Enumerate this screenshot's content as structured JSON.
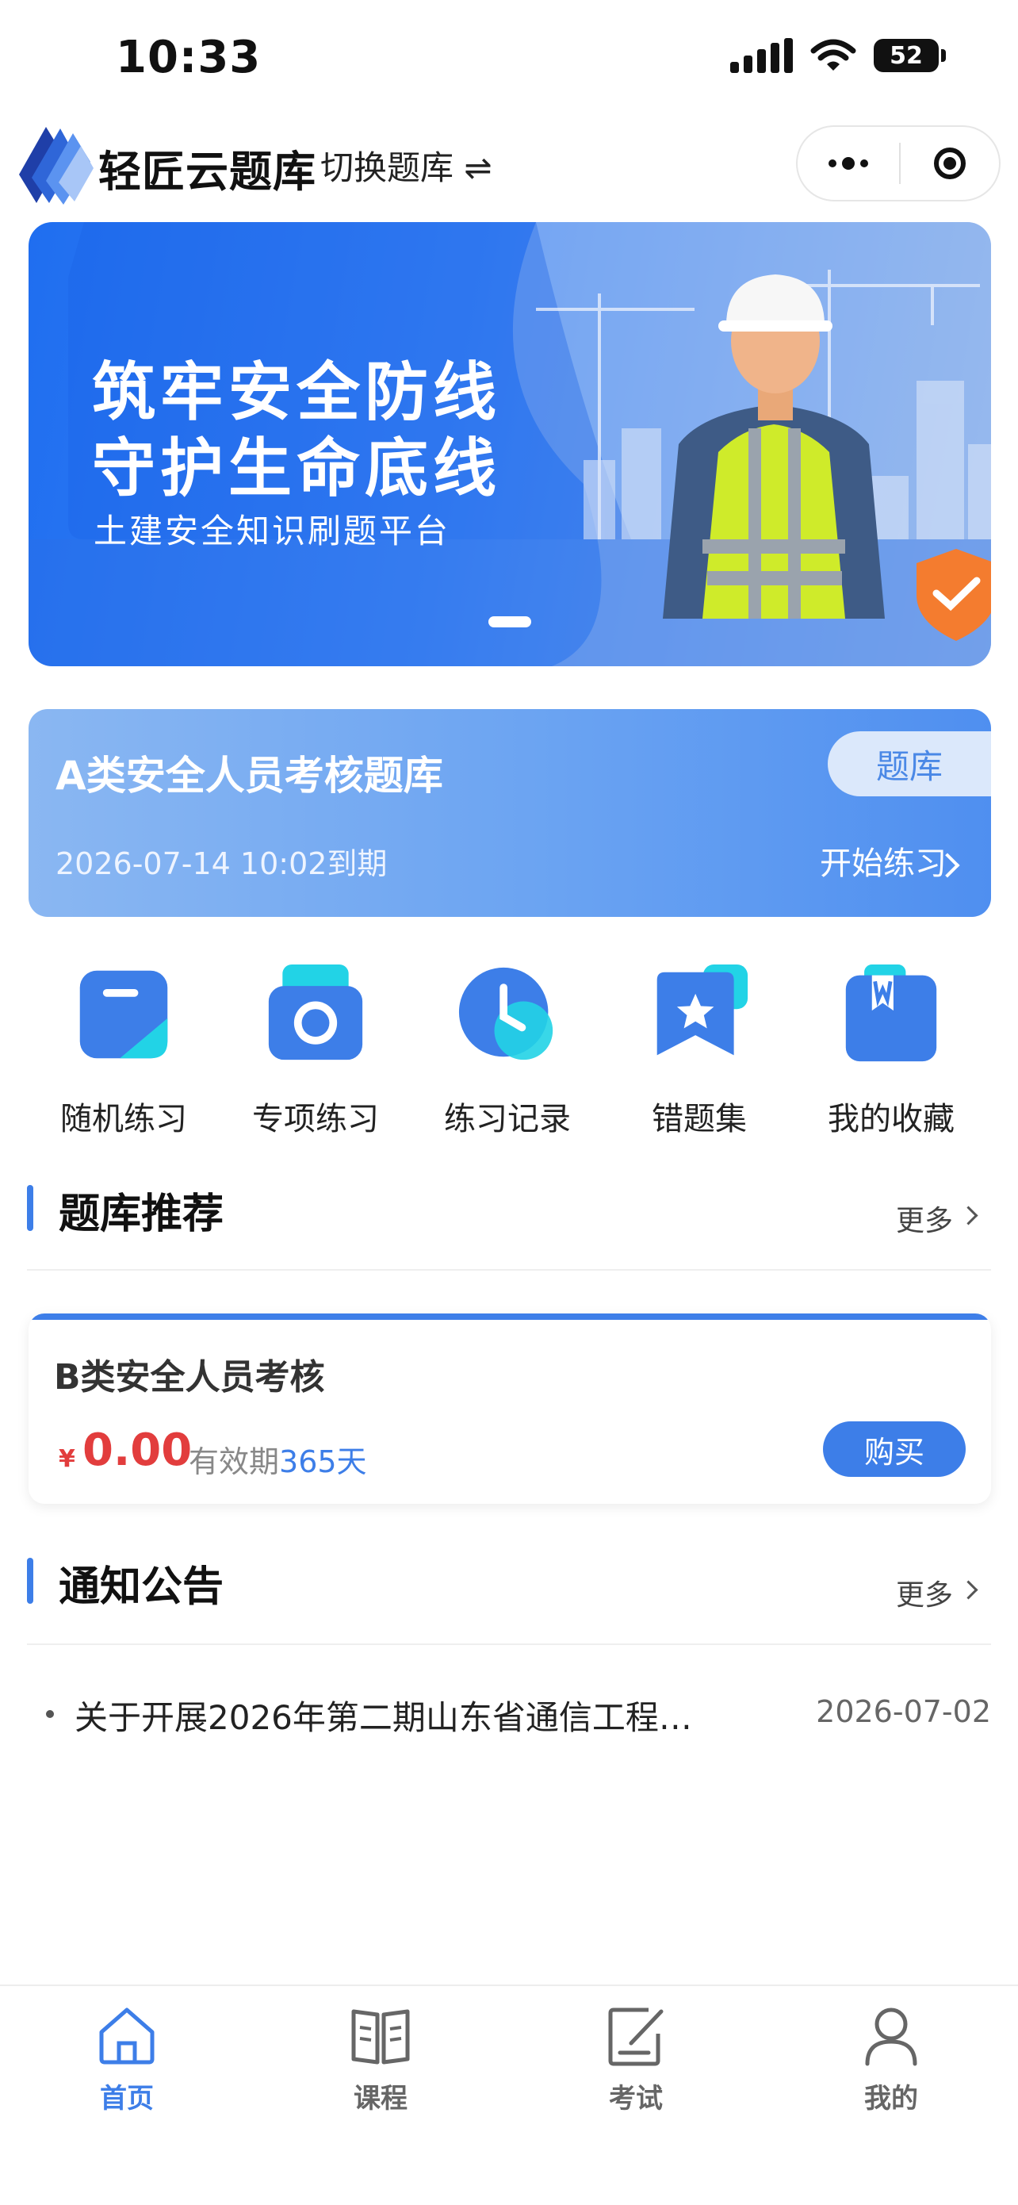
{
  "status_bar": {
    "time": "10:33",
    "battery": "52"
  },
  "header": {
    "app_title": "轻匠云题库",
    "switch_label": "切换题库 ⇌"
  },
  "banner": {
    "line1": "筑牢安全防线",
    "line2": "守护生命底线",
    "subtitle": "土建安全知识刷题平台"
  },
  "current_library": {
    "name": "A类安全人员考核题库",
    "tag": "题库",
    "expire": "2026-07-14 10:02到期",
    "start_label": "开始练习"
  },
  "quick_actions": [
    {
      "label": "随机练习",
      "icon": "random-practice-icon"
    },
    {
      "label": "专项练习",
      "icon": "camera-icon"
    },
    {
      "label": "练习记录",
      "icon": "clock-icon"
    },
    {
      "label": "错题集",
      "icon": "star-bookmark-icon"
    },
    {
      "label": "我的收藏",
      "icon": "bookmark-w-icon"
    }
  ],
  "recommend": {
    "section_title": "题库推荐",
    "more_label": "更多",
    "item": {
      "title": "B类安全人员考核",
      "currency": "¥",
      "price": "0.00",
      "valid_prefix": "有效期",
      "valid_days": "365天",
      "buy_label": "购买"
    }
  },
  "notices": {
    "section_title": "通知公告",
    "more_label": "更多",
    "items": [
      {
        "title": "关于开展2026年第二期山东省通信工程…",
        "date": "2026-07-02"
      }
    ]
  },
  "tabbar": [
    {
      "label": "首页",
      "active": true,
      "icon": "home-icon"
    },
    {
      "label": "课程",
      "active": false,
      "icon": "book-icon"
    },
    {
      "label": "考试",
      "active": false,
      "icon": "exam-edit-icon"
    },
    {
      "label": "我的",
      "active": false,
      "icon": "user-icon"
    }
  ],
  "colors": {
    "primary": "#3d7ee8",
    "price": "#e23d3d"
  }
}
